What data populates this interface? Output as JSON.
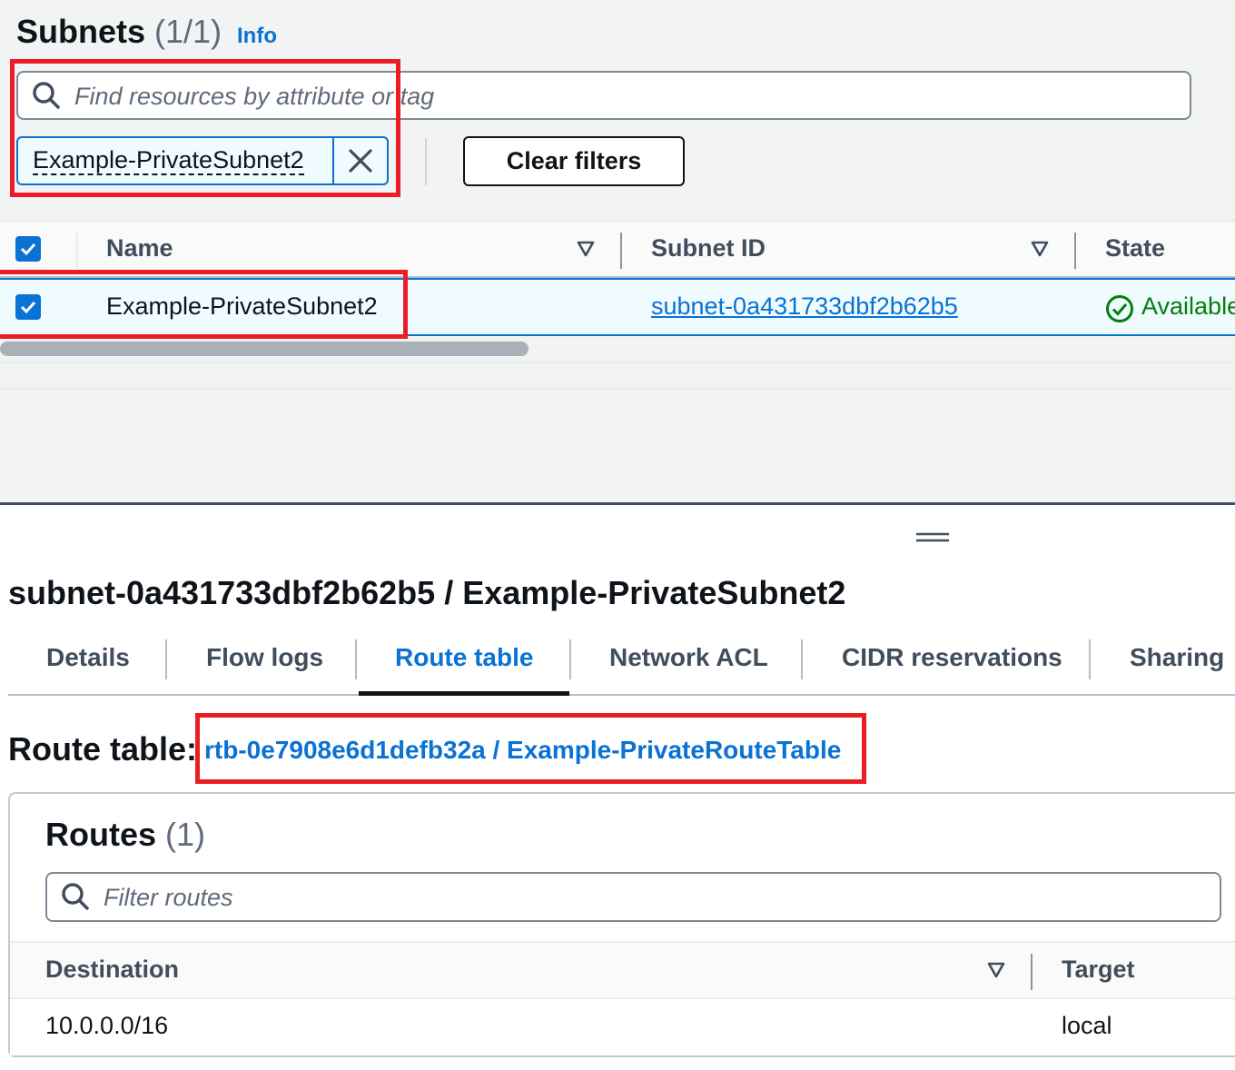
{
  "subnets_panel": {
    "title": "Subnets",
    "count": "(1/1)",
    "info_link": "Info",
    "search_placeholder": "Find resources by attribute or tag",
    "filter_token": "Example-PrivateSubnet2",
    "clear_filters_label": "Clear filters",
    "columns": [
      "Name",
      "Subnet ID",
      "State"
    ],
    "rows": [
      {
        "name": "Example-PrivateSubnet2",
        "subnet_id": "subnet-0a431733dbf2b62b5",
        "state": "Available"
      }
    ]
  },
  "detail_panel": {
    "title": "subnet-0a431733dbf2b62b5 / Example-PrivateSubnet2",
    "tabs": [
      "Details",
      "Flow logs",
      "Route table",
      "Network ACL",
      "CIDR reservations",
      "Sharing"
    ],
    "active_tab": "Route table",
    "route_table_label": "Route table:",
    "route_table_link": "rtb-0e7908e6d1defb32a / Example-PrivateRouteTable",
    "routes": {
      "title": "Routes",
      "count": "(1)",
      "search_placeholder": "Filter routes",
      "columns": [
        "Destination",
        "Target"
      ],
      "rows": [
        {
          "destination": "10.0.0.0/16",
          "target": "local"
        }
      ]
    }
  },
  "colors": {
    "link_blue": "#0972d3",
    "status_green": "#037f0c",
    "highlight_red": "#ec1c24"
  }
}
